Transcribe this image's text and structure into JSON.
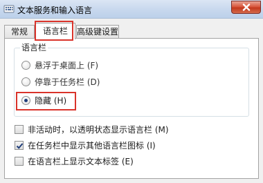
{
  "window": {
    "title": "文本服务和输入语言",
    "close_icon": "close-icon"
  },
  "tabs": [
    {
      "label": "常规",
      "active": false
    },
    {
      "label": "语言栏",
      "active": true
    },
    {
      "label": "高级键设置",
      "active": false
    }
  ],
  "language_bar_group": {
    "label": "语言栏",
    "options": [
      {
        "label": "悬浮于桌面上 (F)",
        "selected": false
      },
      {
        "label": "停靠于任务栏 (D)",
        "selected": false
      },
      {
        "label": "隐藏 (H)",
        "selected": true
      }
    ]
  },
  "checkboxes": [
    {
      "label": "非活动时，以透明状态显示语言栏 (M)",
      "checked": false
    },
    {
      "label": "在任务栏中显示其他语言栏图标 (I)",
      "checked": true
    },
    {
      "label": "在语言栏上显示文本标签 (E)",
      "checked": false
    }
  ],
  "colors": {
    "highlight": "#d9332a",
    "close_button": "#c3391e"
  }
}
